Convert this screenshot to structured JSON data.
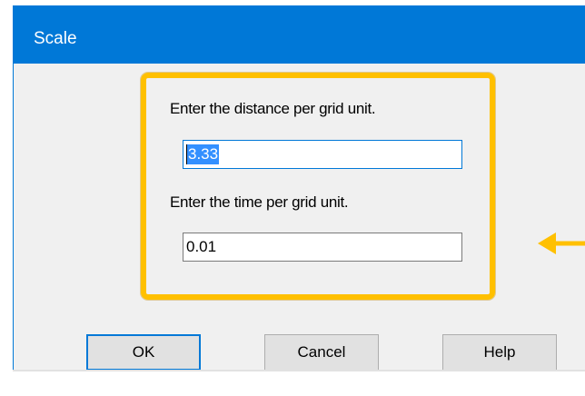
{
  "window": {
    "title": "Scale"
  },
  "distance": {
    "label": "Enter the distance per grid unit.",
    "value": "3.33"
  },
  "time": {
    "label": "Enter the time per grid unit.",
    "value": "0.01"
  },
  "buttons": {
    "ok": "OK",
    "cancel": "Cancel",
    "help": "Help"
  },
  "colors": {
    "titlebar": "#0078d7",
    "highlight": "#ffc000",
    "selection": "#3390ff"
  },
  "icons": {
    "annotation_arrow": "arrow-left-icon"
  }
}
